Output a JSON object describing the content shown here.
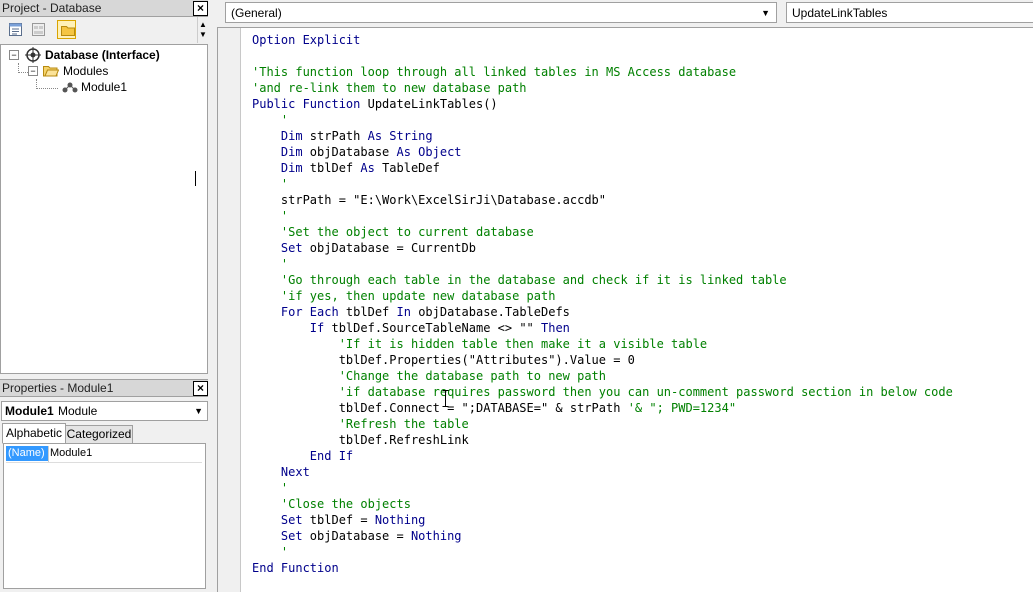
{
  "project_pane": {
    "title": "Project - Database",
    "tree": {
      "root": "Database (Interface)",
      "folder": "Modules",
      "module": "Module1"
    }
  },
  "properties_pane": {
    "title": "Properties - Module1",
    "object_name": "Module1",
    "object_type": "Module",
    "tabs": [
      "Alphabetic",
      "Categorized"
    ],
    "rows": [
      {
        "key": "(Name)",
        "value": "Module1"
      }
    ]
  },
  "code_window": {
    "object_combo": "(General)",
    "proc_combo": "UpdateLinkTables",
    "lines": [
      [
        {
          "t": "kw",
          "s": "Option Explicit"
        }
      ],
      [],
      [
        {
          "t": "cm",
          "s": "'This function loop through all linked tables in MS Access database"
        }
      ],
      [
        {
          "t": "cm",
          "s": "'and re-link them to new database path"
        }
      ],
      [
        {
          "t": "kw",
          "s": "Public Function "
        },
        {
          "t": "tx",
          "s": "UpdateLinkTables()"
        }
      ],
      [
        {
          "t": "cm",
          "s": "    '"
        }
      ],
      [
        {
          "t": "kw",
          "s": "    Dim "
        },
        {
          "t": "tx",
          "s": "strPath "
        },
        {
          "t": "kw",
          "s": "As String"
        }
      ],
      [
        {
          "t": "kw",
          "s": "    Dim "
        },
        {
          "t": "tx",
          "s": "objDatabase "
        },
        {
          "t": "kw",
          "s": "As Object"
        }
      ],
      [
        {
          "t": "kw",
          "s": "    Dim "
        },
        {
          "t": "tx",
          "s": "tblDef "
        },
        {
          "t": "kw",
          "s": "As "
        },
        {
          "t": "tx",
          "s": "TableDef"
        }
      ],
      [
        {
          "t": "cm",
          "s": "    '"
        }
      ],
      [
        {
          "t": "tx",
          "s": "    strPath = \"E:\\Work\\ExcelSirJi\\Database.accdb\""
        }
      ],
      [
        {
          "t": "cm",
          "s": "    '"
        }
      ],
      [
        {
          "t": "cm",
          "s": "    'Set the object to current database"
        }
      ],
      [
        {
          "t": "kw",
          "s": "    Set "
        },
        {
          "t": "tx",
          "s": "objDatabase = CurrentDb"
        }
      ],
      [
        {
          "t": "cm",
          "s": "    '"
        }
      ],
      [
        {
          "t": "cm",
          "s": "    'Go through each table in the database and check if it is linked table"
        }
      ],
      [
        {
          "t": "cm",
          "s": "    'if yes, then update new database path"
        }
      ],
      [
        {
          "t": "kw",
          "s": "    For Each "
        },
        {
          "t": "tx",
          "s": "tblDef "
        },
        {
          "t": "kw",
          "s": "In "
        },
        {
          "t": "tx",
          "s": "objDatabase.TableDefs"
        }
      ],
      [
        {
          "t": "kw",
          "s": "        If "
        },
        {
          "t": "tx",
          "s": "tblDef.SourceTableName <> \"\" "
        },
        {
          "t": "kw",
          "s": "Then"
        }
      ],
      [
        {
          "t": "cm",
          "s": "            'If it is hidden table then make it a visible table"
        }
      ],
      [
        {
          "t": "tx",
          "s": "            tblDef.Properties(\"Attributes\").Value = 0"
        }
      ],
      [
        {
          "t": "cm",
          "s": "            'Change the database path to new path"
        }
      ],
      [
        {
          "t": "cm",
          "s": "            'if database requires password then you can un-comment password section in below code"
        }
      ],
      [
        {
          "t": "tx",
          "s": "            tblDef.Connect = \";DATABASE=\" & strPath "
        },
        {
          "t": "cm",
          "s": "'& \"; PWD=1234\""
        }
      ],
      [
        {
          "t": "cm",
          "s": "            'Refresh the table"
        }
      ],
      [
        {
          "t": "tx",
          "s": "            tblDef.RefreshLink"
        }
      ],
      [
        {
          "t": "kw",
          "s": "        End If"
        }
      ],
      [
        {
          "t": "kw",
          "s": "    Next"
        }
      ],
      [
        {
          "t": "cm",
          "s": "    '"
        }
      ],
      [
        {
          "t": "cm",
          "s": "    'Close the objects"
        }
      ],
      [
        {
          "t": "kw",
          "s": "    Set "
        },
        {
          "t": "tx",
          "s": "tblDef = "
        },
        {
          "t": "kw",
          "s": "Nothing"
        }
      ],
      [
        {
          "t": "kw",
          "s": "    Set "
        },
        {
          "t": "tx",
          "s": "objDatabase = "
        },
        {
          "t": "kw",
          "s": "Nothing"
        }
      ],
      [
        {
          "t": "cm",
          "s": "    '"
        }
      ],
      [
        {
          "t": "kw",
          "s": "End Function"
        }
      ]
    ]
  },
  "colors": {
    "keyword": "#00008b",
    "comment": "#008000",
    "selection": "#3399ff"
  }
}
